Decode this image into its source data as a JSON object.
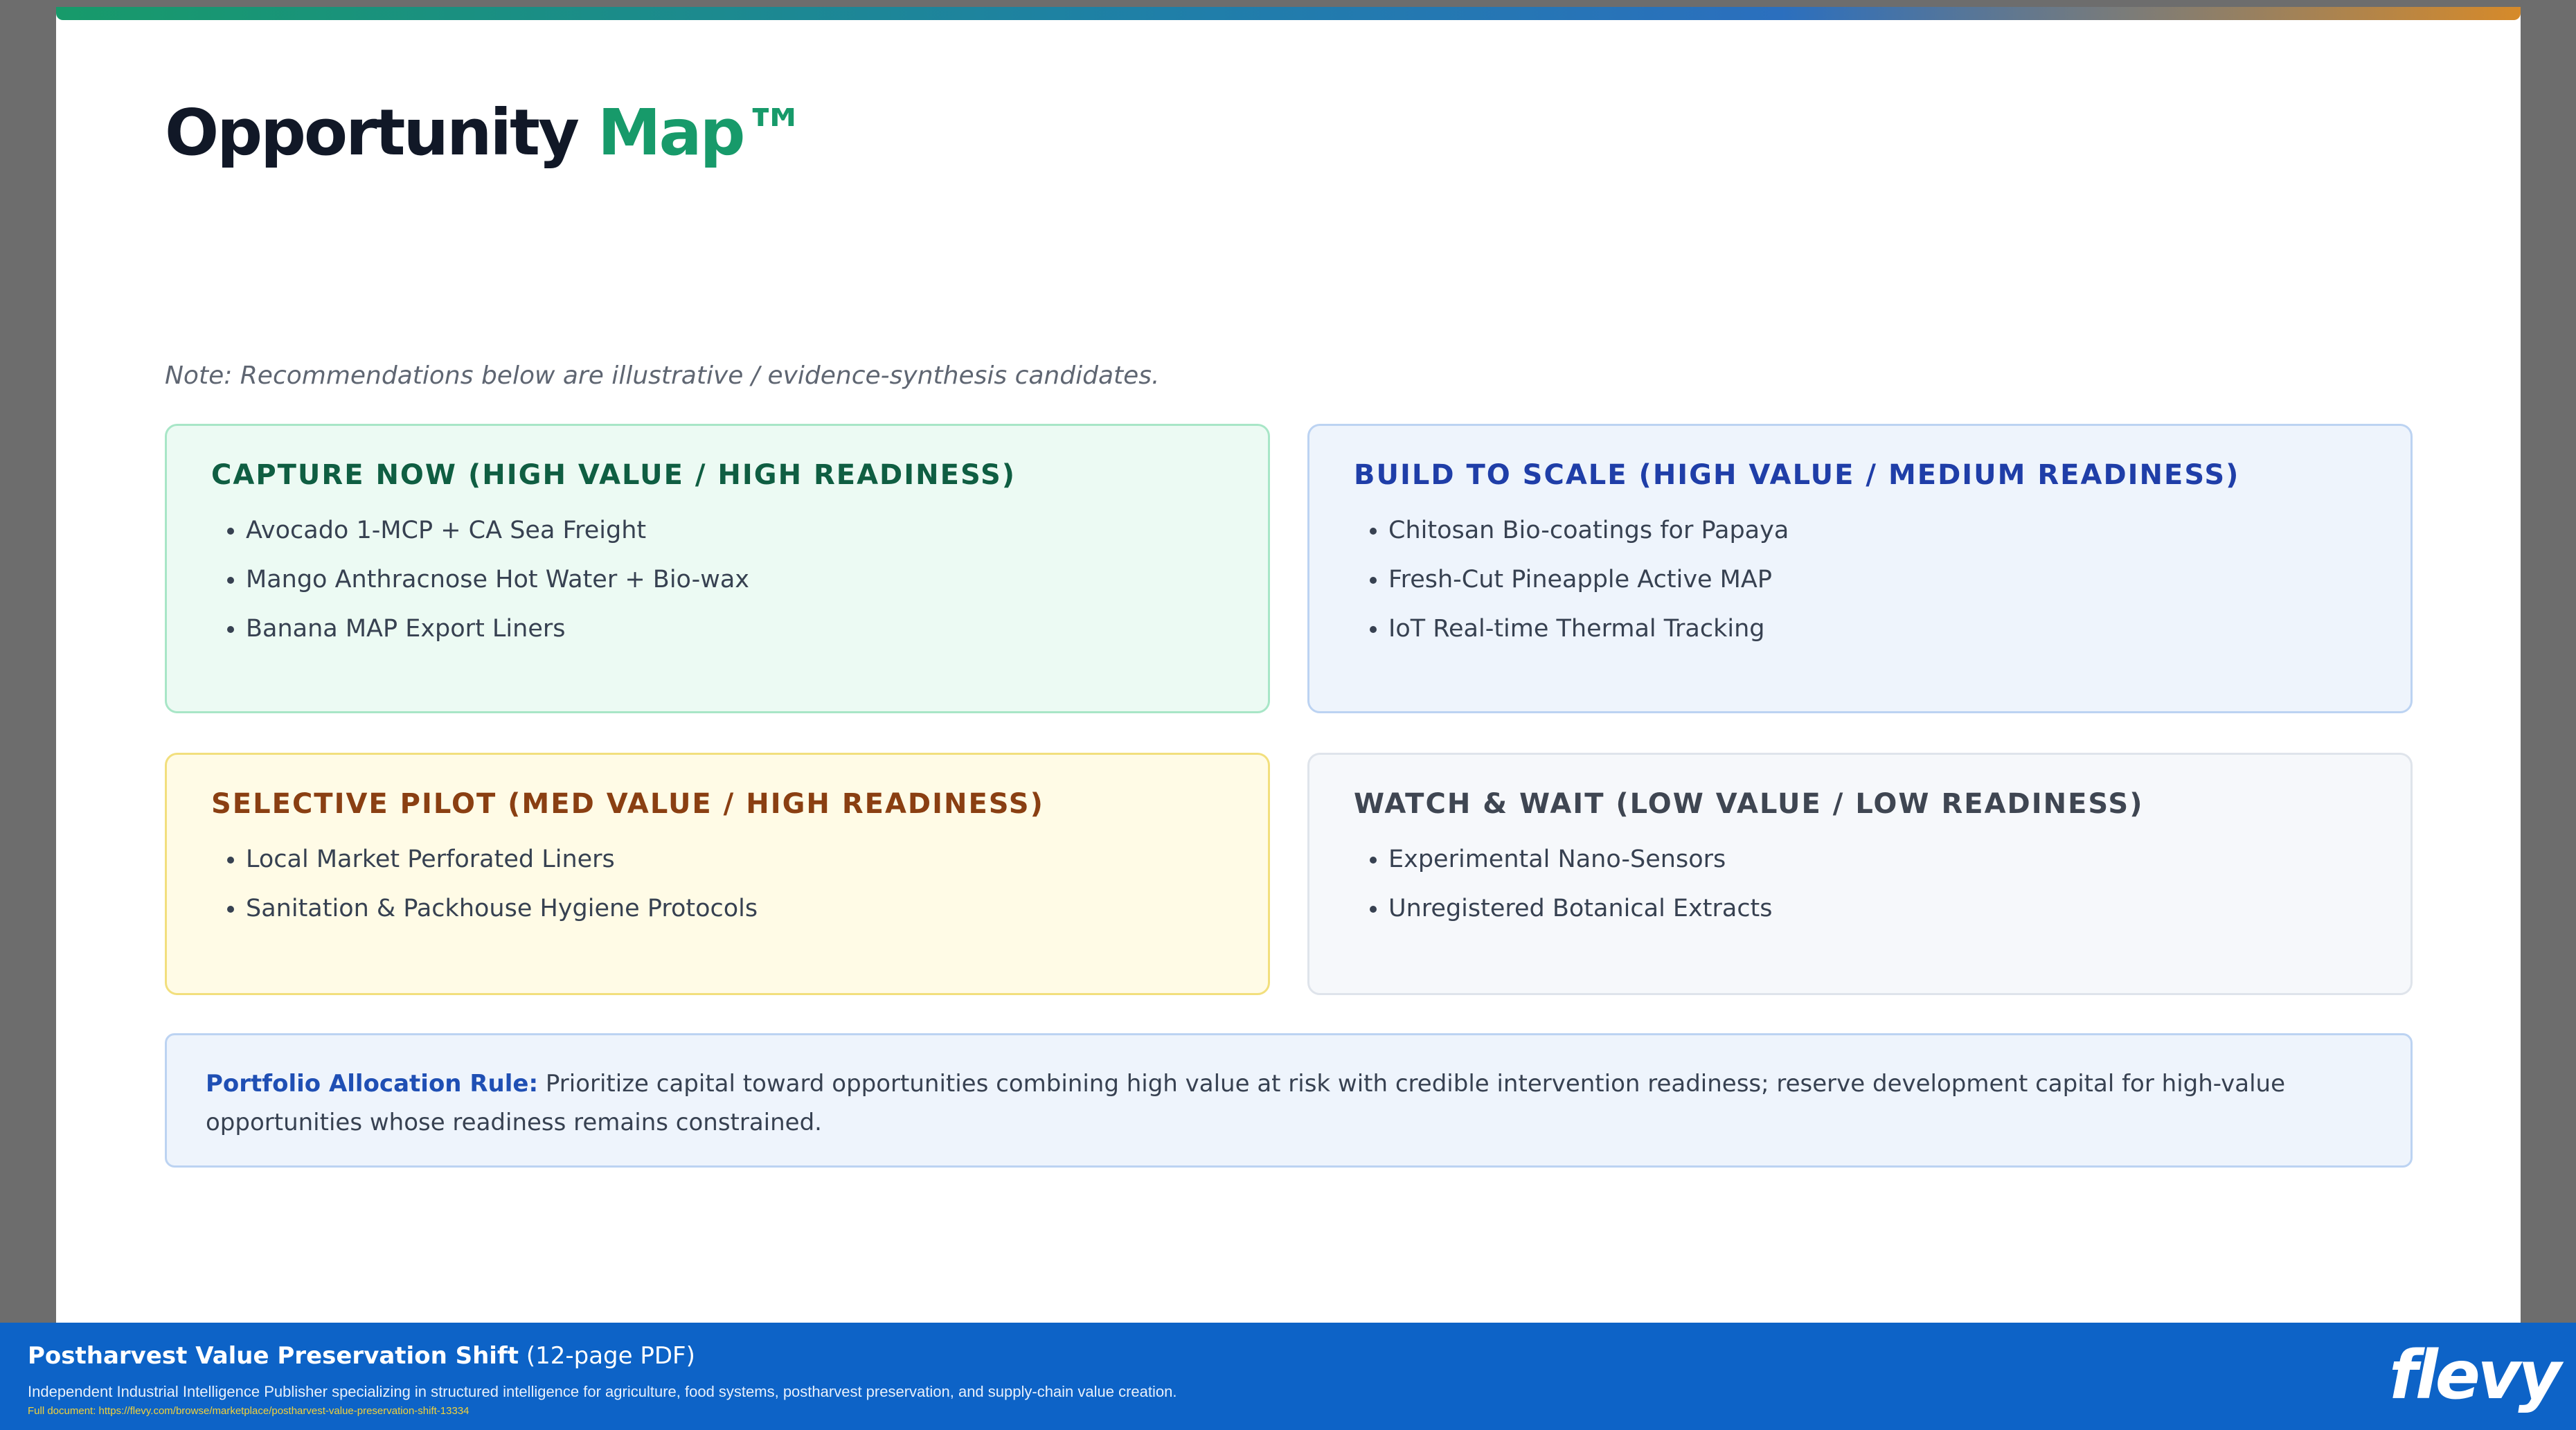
{
  "slide": {
    "title_main": "Opportunity",
    "title_accent": "Map™",
    "note": "Note: Recommendations below are illustrative / evidence-synthesis candidates."
  },
  "quadrants": {
    "capture_now": {
      "heading": "CAPTURE NOW (HIGH VALUE / HIGH READINESS)",
      "items": [
        "Avocado 1-MCP + CA Sea Freight",
        "Mango Anthracnose Hot Water + Bio-wax",
        "Banana MAP Export Liners"
      ]
    },
    "build_to_scale": {
      "heading": "BUILD TO SCALE (HIGH VALUE / MEDIUM READINESS)",
      "items": [
        "Chitosan Bio-coatings for Papaya",
        "Fresh-Cut Pineapple Active MAP",
        "IoT Real-time Thermal Tracking"
      ]
    },
    "selective_pilot": {
      "heading": "SELECTIVE PILOT (MED VALUE / HIGH READINESS)",
      "items": [
        "Local Market Perforated Liners",
        "Sanitation & Packhouse Hygiene Protocols"
      ]
    },
    "watch_wait": {
      "heading": "WATCH & WAIT (LOW VALUE / LOW READINESS)",
      "items": [
        "Experimental Nano-Sensors",
        "Unregistered Botanical Extracts"
      ]
    }
  },
  "rule": {
    "label": "Portfolio Allocation Rule:",
    "text": "Prioritize capital toward opportunities combining high value at risk with credible intervention readiness; reserve development capital for high-value opportunities whose readiness remains constrained."
  },
  "footer": {
    "doc_title": "Postharvest Value Preservation Shift",
    "doc_meta": "(12-page PDF)",
    "subtitle": "Independent Industrial Intelligence Publisher specializing in structured intelligence for agriculture, food systems, postharvest preservation, and supply-chain value creation.",
    "link": "Full document: https://flevy.com/browse/marketplace/postharvest-value-preservation-shift-13334",
    "logo": "flevy"
  },
  "colors": {
    "accent_green": "#179a6a",
    "capture_heading": "#0f5e42",
    "build_heading": "#1f3ea8",
    "pilot_heading": "#8a3f12",
    "watch_heading": "#3f4652",
    "footer_bg": "#0d63c7",
    "link_yellow": "#f2d23a"
  }
}
